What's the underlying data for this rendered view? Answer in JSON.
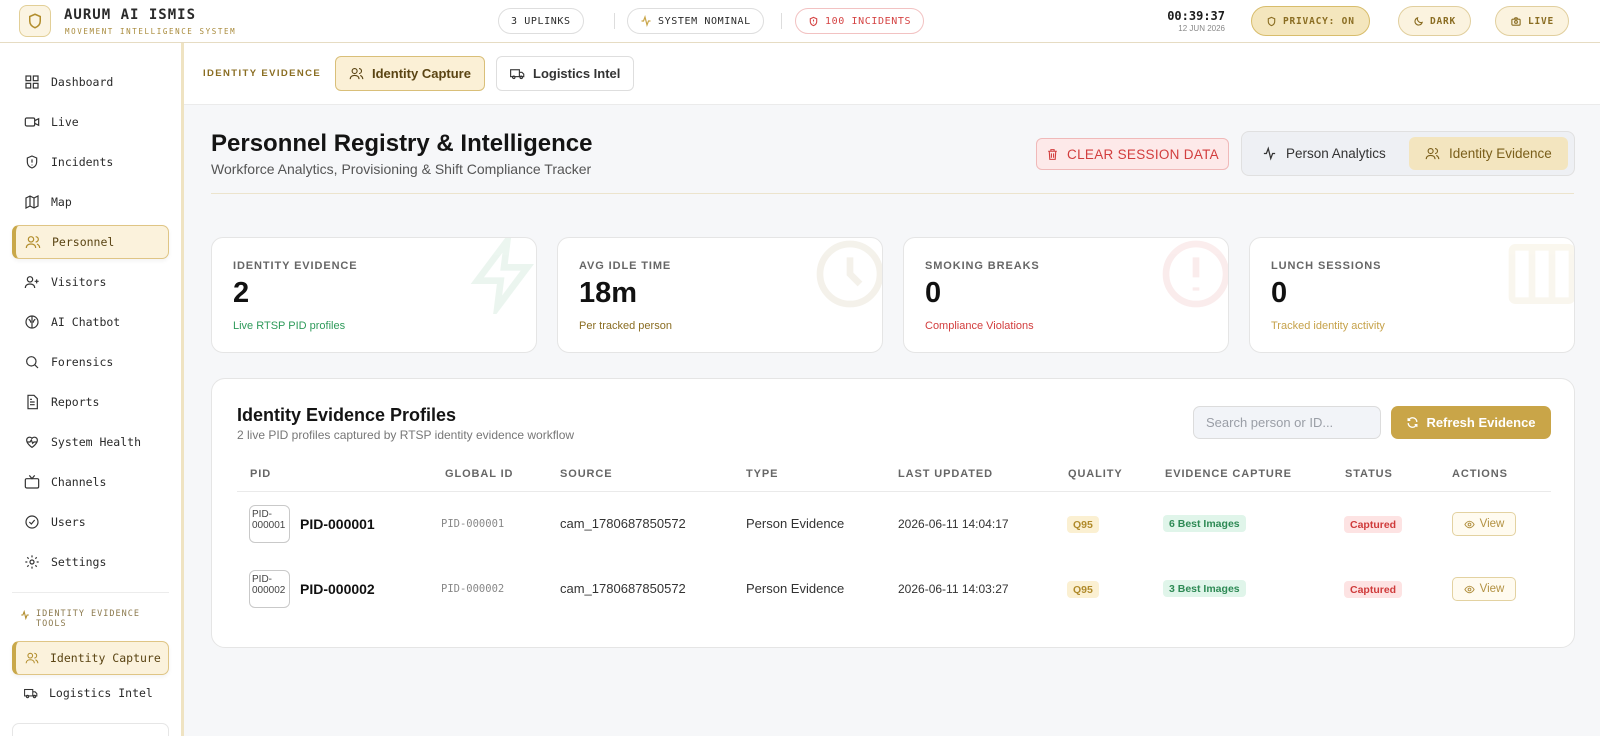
{
  "app": {
    "title": "AURUM AI ISMIS",
    "subtitle": "MOVEMENT INTELLIGENCE SYSTEM"
  },
  "topbar": {
    "uplinks": "3 UPLINKS",
    "system": "SYSTEM NOMINAL",
    "incidents": "100 INCIDENTS",
    "time": "00:39:37",
    "date": "12 JUN 2026",
    "privacy": "PRIVACY: ON",
    "theme": "DARK",
    "live": "LIVE"
  },
  "sidebar": {
    "items": [
      {
        "label": "Dashboard",
        "icon": "grid-icon"
      },
      {
        "label": "Live",
        "icon": "video-icon"
      },
      {
        "label": "Incidents",
        "icon": "alert-icon"
      },
      {
        "label": "Map",
        "icon": "map-icon"
      },
      {
        "label": "Personnel",
        "icon": "users-icon"
      },
      {
        "label": "Visitors",
        "icon": "user-plus-icon"
      },
      {
        "label": "AI Chatbot",
        "icon": "brain-icon"
      },
      {
        "label": "Forensics",
        "icon": "search-icon"
      },
      {
        "label": "Reports",
        "icon": "file-icon"
      },
      {
        "label": "System Health",
        "icon": "heart-pulse-icon"
      },
      {
        "label": "Channels",
        "icon": "tv-icon"
      },
      {
        "label": "Users",
        "icon": "check-circle-icon"
      },
      {
        "label": "Settings",
        "icon": "gear-icon"
      }
    ],
    "section_title_1": "IDENTITY EVIDENCE",
    "section_title_2": "TOOLS",
    "tools": [
      {
        "label": "Identity Capture"
      },
      {
        "label": "Logistics Intel"
      }
    ]
  },
  "subtabs": {
    "label": "IDENTITY EVIDENCE",
    "tabs": [
      {
        "label": "Identity Capture"
      },
      {
        "label": "Logistics Intel"
      }
    ]
  },
  "header": {
    "title": "Personnel Registry & Intelligence",
    "subtitle": "Workforce Analytics, Provisioning & Shift Compliance Tracker",
    "clear_label": "CLEAR SESSION DATA",
    "seg": [
      {
        "label": "Person Analytics"
      },
      {
        "label": "Identity Evidence"
      }
    ]
  },
  "stats": [
    {
      "label": "IDENTITY EVIDENCE",
      "value": "2",
      "sub": "Live RTSP PID profiles",
      "color": "#2e9a5a"
    },
    {
      "label": "AVG IDLE TIME",
      "value": "18m",
      "sub": "Per tracked person",
      "color": "#8a6d22"
    },
    {
      "label": "SMOKING BREAKS",
      "value": "0",
      "sub": "Compliance Violations",
      "color": "#d23d3d"
    },
    {
      "label": "LUNCH SESSIONS",
      "value": "0",
      "sub": "Tracked identity activity",
      "color": "#c6a24a"
    }
  ],
  "profiles": {
    "title": "Identity Evidence Profiles",
    "subtitle": "2 live PID profiles captured by RTSP identity evidence workflow",
    "search_placeholder": "Search person or ID...",
    "refresh_label": "Refresh Evidence",
    "columns": [
      "PID",
      "GLOBAL ID",
      "SOURCE",
      "TYPE",
      "LAST UPDATED",
      "QUALITY",
      "EVIDENCE CAPTURE",
      "STATUS",
      "ACTIONS"
    ],
    "rows": [
      {
        "thumb_alt": "PID-000001",
        "pid": "PID-000001",
        "global_id": "PID-000001",
        "source": "cam_1780687850572",
        "type": "Person Evidence",
        "updated": "2026-06-11 14:04:17",
        "quality": "Q95",
        "evidence": "6 Best Images",
        "status": "Captured",
        "action": "View"
      },
      {
        "thumb_alt": "PID-000002",
        "pid": "PID-000002",
        "global_id": "PID-000002",
        "source": "cam_1780687850572",
        "type": "Person Evidence",
        "updated": "2026-06-11 14:03:27",
        "quality": "Q95",
        "evidence": "3 Best Images",
        "status": "Captured",
        "action": "View"
      }
    ]
  }
}
